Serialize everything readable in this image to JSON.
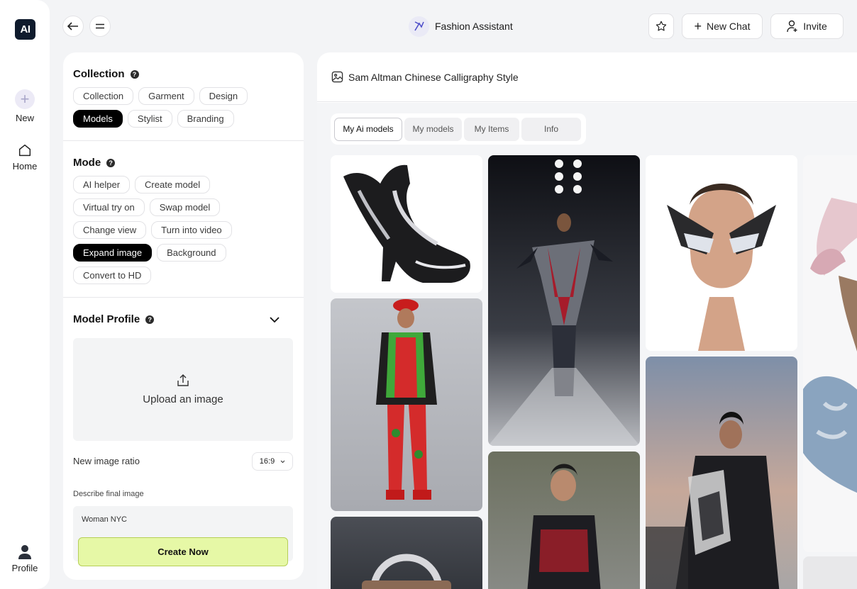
{
  "rail": {
    "logo": "AI",
    "new_label": "New",
    "home_label": "Home",
    "profile_label": "Profile"
  },
  "topbar": {
    "title": "Fashion Assistant",
    "new_chat_label": "New Chat",
    "invite_label": "Invite"
  },
  "panel": {
    "collection": {
      "title": "Collection",
      "chips": [
        "Collection",
        "Garment",
        "Design",
        "Models",
        "Stylist",
        "Branding"
      ],
      "active": "Models"
    },
    "mode": {
      "title": "Mode",
      "chips": [
        "AI helper",
        "Create model",
        "Virtual try on",
        "Swap model",
        "Change view",
        "Turn into video",
        "Expand image",
        "Background",
        "Convert to HD"
      ],
      "active": "Expand image"
    },
    "model_profile": {
      "title": "Model Profile",
      "upload_label": "Upload an image",
      "ratio_label": "New image ratio",
      "ratio_value": "16:9",
      "describe_label": "Describe final image",
      "describe_value": "Woman NYC",
      "create_label": "Create Now"
    }
  },
  "main": {
    "header_title": "Sam Altman Chinese Calligraphy Style",
    "tabs": [
      "My Ai models",
      "My models",
      "My Items",
      "Info"
    ],
    "active_tab": "My Ai models"
  },
  "colors": {
    "accent_green": "#e6f8a6",
    "logo_bg": "#0f1b2d"
  }
}
